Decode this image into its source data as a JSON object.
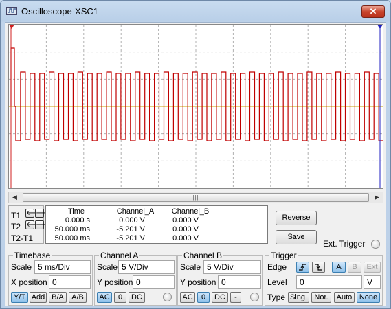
{
  "window": {
    "title": "Oscilloscope-XSC1",
    "close_label": "✕"
  },
  "colors": {
    "trace_a": "#c00000",
    "trace_b": "#c8a000",
    "cursor1": "#d02020",
    "cursor2": "#2020c0"
  },
  "cursors": {
    "t1": "T1",
    "t2": "T2",
    "t2t1": "T2-T1",
    "left_arrow": "🡐",
    "right_arrow": "🡒"
  },
  "readout": {
    "headers": [
      "Time",
      "Channel_A",
      "Channel_B"
    ],
    "rows": [
      [
        "0.000 s",
        "0.000 V",
        "0.000 V"
      ],
      [
        "50.000 ms",
        "-5.201 V",
        "0.000 V"
      ],
      [
        "50.000 ms",
        "-5.201 V",
        "0.000 V"
      ]
    ]
  },
  "buttons": {
    "reverse": "Reverse",
    "save": "Save",
    "ext_trigger": "Ext. Trigger"
  },
  "timebase": {
    "title": "Timebase",
    "scale_label": "Scale",
    "scale_value": "5 ms/Div",
    "xpos_label": "X position",
    "xpos_value": "0",
    "modes": [
      "Y/T",
      "Add",
      "B/A",
      "A/B"
    ],
    "active_mode": "Y/T"
  },
  "channel_a": {
    "title": "Channel A",
    "scale_label": "Scale",
    "scale_value": "5  V/Div",
    "ypos_label": "Y position",
    "ypos_value": "0",
    "coupling": [
      "AC",
      "0",
      "DC"
    ]
  },
  "channel_b": {
    "title": "Channel B",
    "scale_label": "Scale",
    "scale_value": "5  V/Div",
    "ypos_label": "Y position",
    "ypos_value": "0",
    "coupling": [
      "AC",
      "0",
      "DC",
      "-"
    ]
  },
  "trigger": {
    "title": "Trigger",
    "edge_label": "Edge",
    "sources": [
      "A",
      "B",
      "Ext"
    ],
    "level_label": "Level",
    "level_value": "0",
    "level_unit": "V",
    "type_label": "Type",
    "types": [
      "Sing.",
      "Nor.",
      "Auto",
      "None"
    ],
    "active_type": "None"
  },
  "scrollbar": {
    "left": "◀",
    "right": "▶",
    "grip": "|||"
  }
}
